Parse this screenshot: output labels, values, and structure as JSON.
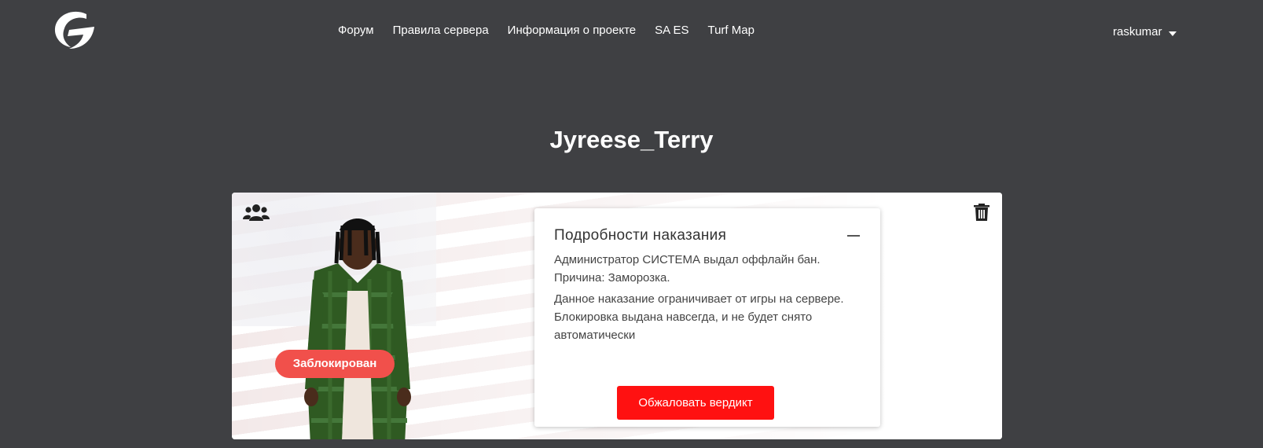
{
  "header": {
    "nav": [
      "Форум",
      "Правила сервера",
      "Информация о проекте",
      "SA ES",
      "Turf Map"
    ],
    "username": "raskumar"
  },
  "profile": {
    "player_name": "Jyreese_Terry",
    "status_badge": "Заблокирован"
  },
  "punishment": {
    "title": "Подробности наказания",
    "line1": "Администратор СИСТЕМА выдал оффлайн бан.",
    "line2": "Причина: Заморозка.",
    "line3": "Данное наказание ограничивает от игры на сервере. Блокировка выдана навсегда, и не будет снято автоматически",
    "appeal_button": "Обжаловать вердикт"
  },
  "icons": {
    "logo": "site-logo-icon",
    "group": "group-icon",
    "trash": "trash-icon",
    "caret": "chevron-down-icon",
    "collapse": "minus-icon"
  },
  "colors": {
    "background": "#3f4043",
    "badge": "#f1504b",
    "appeal": "#ff1111"
  }
}
